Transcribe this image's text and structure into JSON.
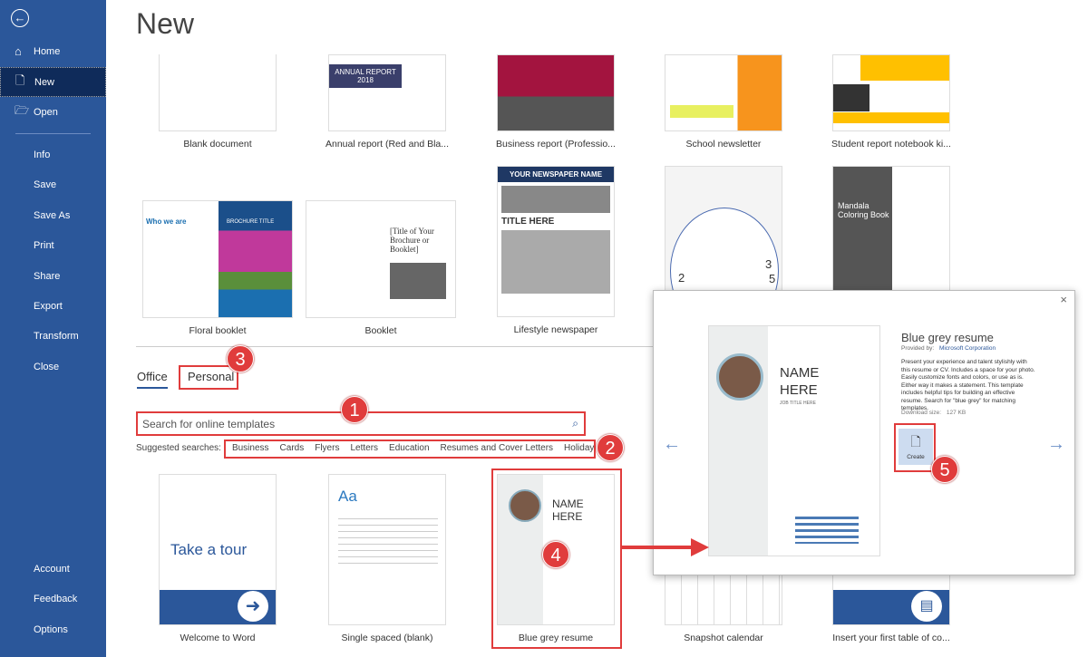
{
  "sidebar": {
    "back_icon": "back-arrow-icon",
    "items": [
      {
        "label": "Home",
        "icon": "home-icon"
      },
      {
        "label": "New",
        "icon": "document-icon"
      },
      {
        "label": "Open",
        "icon": "folder-open-icon"
      },
      {
        "label": "Info"
      },
      {
        "label": "Save"
      },
      {
        "label": "Save As"
      },
      {
        "label": "Print"
      },
      {
        "label": "Share"
      },
      {
        "label": "Export"
      },
      {
        "label": "Transform"
      },
      {
        "label": "Close"
      }
    ],
    "bottom": [
      {
        "label": "Account"
      },
      {
        "label": "Feedback"
      },
      {
        "label": "Options"
      }
    ],
    "bg_color": "#2b579a",
    "active_color": "#0f2b5a"
  },
  "header": {
    "title": "New"
  },
  "templates_row1": [
    "Blank document",
    "Annual report (Red and Bla...",
    "Business report (Professio...",
    "School newsletter",
    "Student report notebook ki..."
  ],
  "templates_row2": [
    "Floral booklet",
    "Booklet",
    "Lifestyle newspaper"
  ],
  "templates_row3": [
    "Welcome to Word",
    "Single spaced (blank)",
    "Blue grey resume",
    "Snapshot calendar",
    "Insert your first table of co..."
  ],
  "thumb_text": {
    "annual": "ANNUAL REPORT 2018",
    "newspaper": "YOUR NEWSPAPER NAME",
    "title_here": "TITLE HERE",
    "booklet": "[Title of Your Brochure or Booklet]",
    "brochure": "BROCHURE TITLE",
    "floral_who": "Who we are",
    "mandala": "Mandala Coloring Book",
    "tour": "Take a tour",
    "aa": "Aa",
    "name": "NAME HERE",
    "job": "JOB TITLE HERE",
    "calendar_nums": [
      "2",
      "3",
      "5"
    ]
  },
  "tabs": [
    {
      "label": "Office",
      "active": true
    },
    {
      "label": "Personal"
    }
  ],
  "search": {
    "placeholder": "Search for online templates"
  },
  "suggested": {
    "label": "Suggested searches:",
    "items": [
      "Business",
      "Cards",
      "Flyers",
      "Letters",
      "Education",
      "Resumes and Cover Letters",
      "Holiday"
    ]
  },
  "callouts": [
    "1",
    "2",
    "3",
    "4",
    "5"
  ],
  "callout_color": "#e03c3c",
  "dialog": {
    "title": "Blue grey resume",
    "provided_by_label": "Provided by:",
    "provider": "Microsoft Corporation",
    "description": "Present your experience and talent stylishly with this resume or CV.  Includes a space for your photo. Easily customize fonts and colors, or use as is.  Either way it makes a statement. This template includes helpful tips for building an effective resume. Search for \"blue grey\" for matching templates.",
    "download_label": "Download size:",
    "download_size": "127 KB",
    "create_label": "Create",
    "close": "×",
    "prev": "←",
    "next": "→"
  }
}
